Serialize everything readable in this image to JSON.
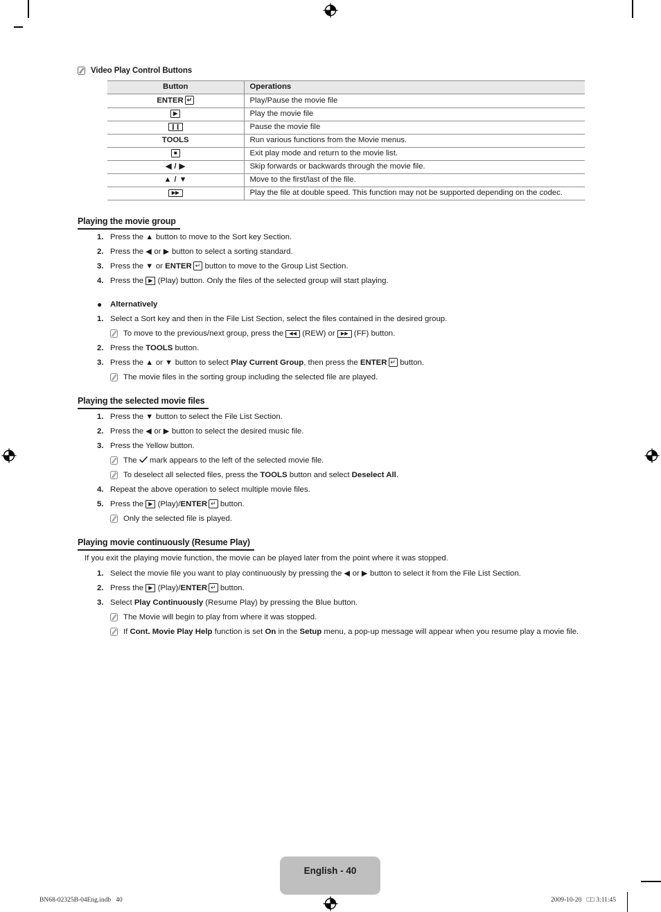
{
  "document": {
    "note_icon_name": "note-pencil-icon",
    "note_heading": "Video Play Control Buttons"
  },
  "table": {
    "name": "video-play-control-buttons-table",
    "headers": [
      "Button",
      "Operations"
    ],
    "rows": [
      {
        "button_text": "ENTER",
        "button_glyph": "enter-key",
        "operation": "Play/Pause the movie file"
      },
      {
        "button_text": "",
        "button_glyph": "play-key",
        "operation": "Play the movie file"
      },
      {
        "button_text": "",
        "button_glyph": "pause-key",
        "operation": "Pause the movie file"
      },
      {
        "button_text": "TOOLS",
        "button_glyph": "none",
        "operation": "Run various functions from the Movie menus."
      },
      {
        "button_text": "",
        "button_glyph": "stop-key",
        "operation": "Exit play mode and return to the movie list."
      },
      {
        "button_text": "",
        "button_glyph": "left-right-arrows",
        "operation": "Skip forwards or backwards through the movie file."
      },
      {
        "button_text": "",
        "button_glyph": "up-down-arrows",
        "operation": "Move to the first/last of the file."
      },
      {
        "button_text": "",
        "button_glyph": "fast-forward-key",
        "operation": "Play the file at double speed. This function may not be supported depending on the codec."
      }
    ]
  },
  "sections": [
    {
      "id": "playing-the-movie-group",
      "heading": "Playing the movie group",
      "steps": [
        {
          "num": "1.",
          "parts": [
            {
              "t": "text",
              "v": "Press the "
            },
            {
              "t": "glyph",
              "v": "up-arrow"
            },
            {
              "t": "text",
              "v": " button to move to the Sort key Section."
            }
          ]
        },
        {
          "num": "2.",
          "parts": [
            {
              "t": "text",
              "v": "Press the "
            },
            {
              "t": "glyph",
              "v": "left-arrow"
            },
            {
              "t": "text",
              "v": " or "
            },
            {
              "t": "glyph",
              "v": "right-arrow"
            },
            {
              "t": "text",
              "v": " button to select a sorting standard."
            }
          ]
        },
        {
          "num": "3.",
          "parts": [
            {
              "t": "text",
              "v": "Press the "
            },
            {
              "t": "glyph",
              "v": "down-arrow"
            },
            {
              "t": "text",
              "v": " or "
            },
            {
              "t": "bold",
              "v": "ENTER"
            },
            {
              "t": "glyph",
              "v": "enter-key"
            },
            {
              "t": "text",
              "v": " button to move to the Group List Section."
            }
          ]
        },
        {
          "num": "4.",
          "parts": [
            {
              "t": "text",
              "v": "Press the "
            },
            {
              "t": "glyph",
              "v": "play-key"
            },
            {
              "t": "text",
              "v": " (Play) button. Only the files of the selected group will start playing."
            }
          ]
        }
      ],
      "alternatively_label": "Alternatively",
      "alt_steps": [
        {
          "num": "1.",
          "parts": [
            {
              "t": "text",
              "v": "Select a Sort key and then in the File List Section, select the files contained in the desired group."
            }
          ]
        },
        {
          "num": "note",
          "parts": [
            {
              "t": "text",
              "v": "To move to the previous/next group, press the "
            },
            {
              "t": "glyph",
              "v": "rewind-key"
            },
            {
              "t": "text",
              "v": " (REW) or "
            },
            {
              "t": "glyph",
              "v": "fast-forward-key"
            },
            {
              "t": "text",
              "v": " (FF) button."
            }
          ]
        },
        {
          "num": "2.",
          "parts": [
            {
              "t": "text",
              "v": "Press the "
            },
            {
              "t": "bold",
              "v": "TOOLS"
            },
            {
              "t": "text",
              "v": " button."
            }
          ]
        },
        {
          "num": "3.",
          "parts": [
            {
              "t": "text",
              "v": "Press the "
            },
            {
              "t": "glyph",
              "v": "up-arrow"
            },
            {
              "t": "text",
              "v": " or "
            },
            {
              "t": "glyph",
              "v": "down-arrow"
            },
            {
              "t": "text",
              "v": " button to select "
            },
            {
              "t": "bold",
              "v": "Play Current Group"
            },
            {
              "t": "text",
              "v": ", then press the "
            },
            {
              "t": "bold",
              "v": "ENTER"
            },
            {
              "t": "glyph",
              "v": "enter-key"
            },
            {
              "t": "text",
              "v": " button."
            }
          ]
        },
        {
          "num": "note",
          "parts": [
            {
              "t": "text",
              "v": "The movie files in the sorting group including the selected file are played."
            }
          ]
        }
      ]
    },
    {
      "id": "playing-the-selected-movie-files",
      "heading": "Playing the selected movie files",
      "steps": [
        {
          "num": "1.",
          "parts": [
            {
              "t": "text",
              "v": "Press the "
            },
            {
              "t": "glyph",
              "v": "down-arrow"
            },
            {
              "t": "text",
              "v": " button to select the File List Section."
            }
          ]
        },
        {
          "num": "2.",
          "parts": [
            {
              "t": "text",
              "v": "Press the "
            },
            {
              "t": "glyph",
              "v": "left-arrow"
            },
            {
              "t": "text",
              "v": " or "
            },
            {
              "t": "glyph",
              "v": "right-arrow"
            },
            {
              "t": "text",
              "v": " button to select the desired music file."
            }
          ]
        },
        {
          "num": "3.",
          "parts": [
            {
              "t": "text",
              "v": "Press the Yellow button."
            }
          ]
        },
        {
          "num": "note",
          "parts": [
            {
              "t": "text",
              "v": "The "
            },
            {
              "t": "glyph",
              "v": "check-mark"
            },
            {
              "t": "text",
              "v": " mark appears to the left of the selected movie file."
            }
          ]
        },
        {
          "num": "note",
          "parts": [
            {
              "t": "text",
              "v": "To deselect all selected files, press the "
            },
            {
              "t": "bold",
              "v": "TOOLS"
            },
            {
              "t": "text",
              "v": " button and select "
            },
            {
              "t": "bold",
              "v": "Deselect All"
            },
            {
              "t": "text",
              "v": "."
            }
          ]
        },
        {
          "num": "4.",
          "parts": [
            {
              "t": "text",
              "v": "Repeat the above operation to select multiple movie files."
            }
          ]
        },
        {
          "num": "5.",
          "parts": [
            {
              "t": "text",
              "v": "Press the "
            },
            {
              "t": "glyph",
              "v": "play-key"
            },
            {
              "t": "text",
              "v": " (Play)/"
            },
            {
              "t": "bold",
              "v": "ENTER"
            },
            {
              "t": "glyph",
              "v": "enter-key"
            },
            {
              "t": "text",
              "v": " button."
            }
          ]
        },
        {
          "num": "note",
          "parts": [
            {
              "t": "text",
              "v": "Only the selected file is played."
            }
          ]
        }
      ]
    },
    {
      "id": "playing-movie-continuously",
      "heading": "Playing movie continuously (Resume Play)",
      "intro": "If you exit the playing movie function, the movie can be played later from the point where it was stopped.",
      "steps": [
        {
          "num": "1.",
          "parts": [
            {
              "t": "text",
              "v": "Select the movie file you want to play continuously by pressing the "
            },
            {
              "t": "glyph",
              "v": "left-arrow"
            },
            {
              "t": "text",
              "v": " or "
            },
            {
              "t": "glyph",
              "v": "right-arrow"
            },
            {
              "t": "text",
              "v": " button to select it from the File List Section."
            }
          ]
        },
        {
          "num": "2.",
          "parts": [
            {
              "t": "text",
              "v": "Press the "
            },
            {
              "t": "glyph",
              "v": "play-key"
            },
            {
              "t": "text",
              "v": " (Play)/"
            },
            {
              "t": "bold",
              "v": "ENTER"
            },
            {
              "t": "glyph",
              "v": "enter-key"
            },
            {
              "t": "text",
              "v": " button."
            }
          ]
        },
        {
          "num": "3.",
          "parts": [
            {
              "t": "text",
              "v": "Select "
            },
            {
              "t": "bold",
              "v": "Play Continuously"
            },
            {
              "t": "text",
              "v": " (Resume Play) by pressing the Blue button."
            }
          ]
        },
        {
          "num": "note",
          "parts": [
            {
              "t": "text",
              "v": "The Movie will begin to play from where it was stopped."
            }
          ]
        },
        {
          "num": "note",
          "parts": [
            {
              "t": "text",
              "v": "If "
            },
            {
              "t": "bold",
              "v": "Cont. Movie Play Help"
            },
            {
              "t": "text",
              "v": " function is set "
            },
            {
              "t": "bold",
              "v": "On"
            },
            {
              "t": "text",
              "v": " in the "
            },
            {
              "t": "bold",
              "v": "Setup"
            },
            {
              "t": "text",
              "v": " menu, a pop-up message will appear when you resume play a movie file."
            }
          ]
        }
      ]
    }
  ],
  "footer": {
    "page_tab_label": "English - 40",
    "left_text": "BN68-02325B-04Eng.indb   40",
    "right_text": "2009-10-20   □□ 3:11:45"
  },
  "colors": {
    "table_header_bg": "#e8e8e8",
    "table_border": "#8d8d8d",
    "page_tab_bg": "#bfbfbf",
    "text": "#1a1a1a"
  }
}
